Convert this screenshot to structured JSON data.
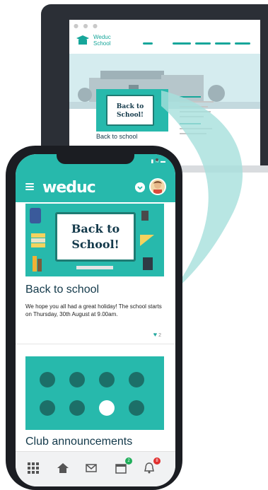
{
  "laptop": {
    "window_dots": "● ● ●",
    "brand_line1": "Weduc",
    "brand_line2": "School",
    "card_line1": "Back to",
    "card_line2": "School!",
    "caption": "Back to school"
  },
  "app": {
    "brand": "weduc",
    "colors": {
      "accent": "#27b9ac",
      "title": "#13394a",
      "badge_green": "#1fae5a",
      "badge_red": "#e1302f"
    }
  },
  "feed": {
    "post1": {
      "board_line1": "Back to",
      "board_line2": "School!",
      "title": "Back to school",
      "body": "We hope you all had a great holiday! The school starts on Thursday, 30th August at 9.00am.",
      "likes": "2"
    },
    "post2": {
      "title": "Club announcements"
    }
  },
  "tabbar": {
    "items": [
      {
        "icon": "grid-icon"
      },
      {
        "icon": "home-icon"
      },
      {
        "icon": "mail-icon"
      },
      {
        "icon": "calendar-icon",
        "badge": "2"
      },
      {
        "icon": "bell-icon",
        "badge": "8"
      }
    ]
  }
}
